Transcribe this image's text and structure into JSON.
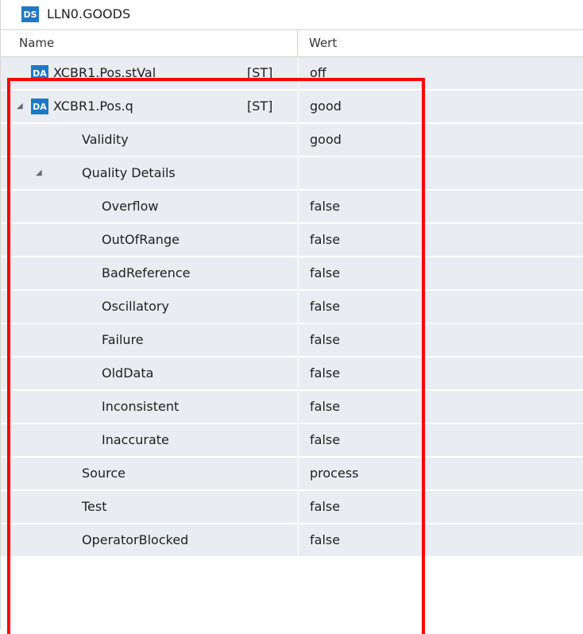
{
  "title": {
    "badge": "DS",
    "text": "LLN0.GOODS"
  },
  "header": {
    "name": "Name",
    "wert": "Wert"
  },
  "rows": [
    {
      "badge": "DA",
      "name": "XCBR1.Pos.stVal",
      "type": "[ST]",
      "value": "off"
    },
    {
      "badge": "DA",
      "name": "XCBR1.Pos.q",
      "type": "[ST]",
      "value": "good",
      "expander": "◢"
    },
    {
      "name": "Validity",
      "value": "good"
    },
    {
      "name": "Quality Details",
      "value": "",
      "expander": "◢"
    },
    {
      "name": "Overflow",
      "value": "false"
    },
    {
      "name": "OutOfRange",
      "value": "false"
    },
    {
      "name": "BadReference",
      "value": "false"
    },
    {
      "name": "Oscillatory",
      "value": "false"
    },
    {
      "name": "Failure",
      "value": "false"
    },
    {
      "name": "OldData",
      "value": "false"
    },
    {
      "name": "Inconsistent",
      "value": "false"
    },
    {
      "name": "Inaccurate",
      "value": "false"
    },
    {
      "name": "Source",
      "value": "process"
    },
    {
      "name": "Test",
      "value": "false"
    },
    {
      "name": "OperatorBlocked",
      "value": "false"
    }
  ],
  "colors": {
    "badge": "#1e78c8",
    "row_bg": "#e9edf1",
    "highlight": "#ff0000"
  }
}
